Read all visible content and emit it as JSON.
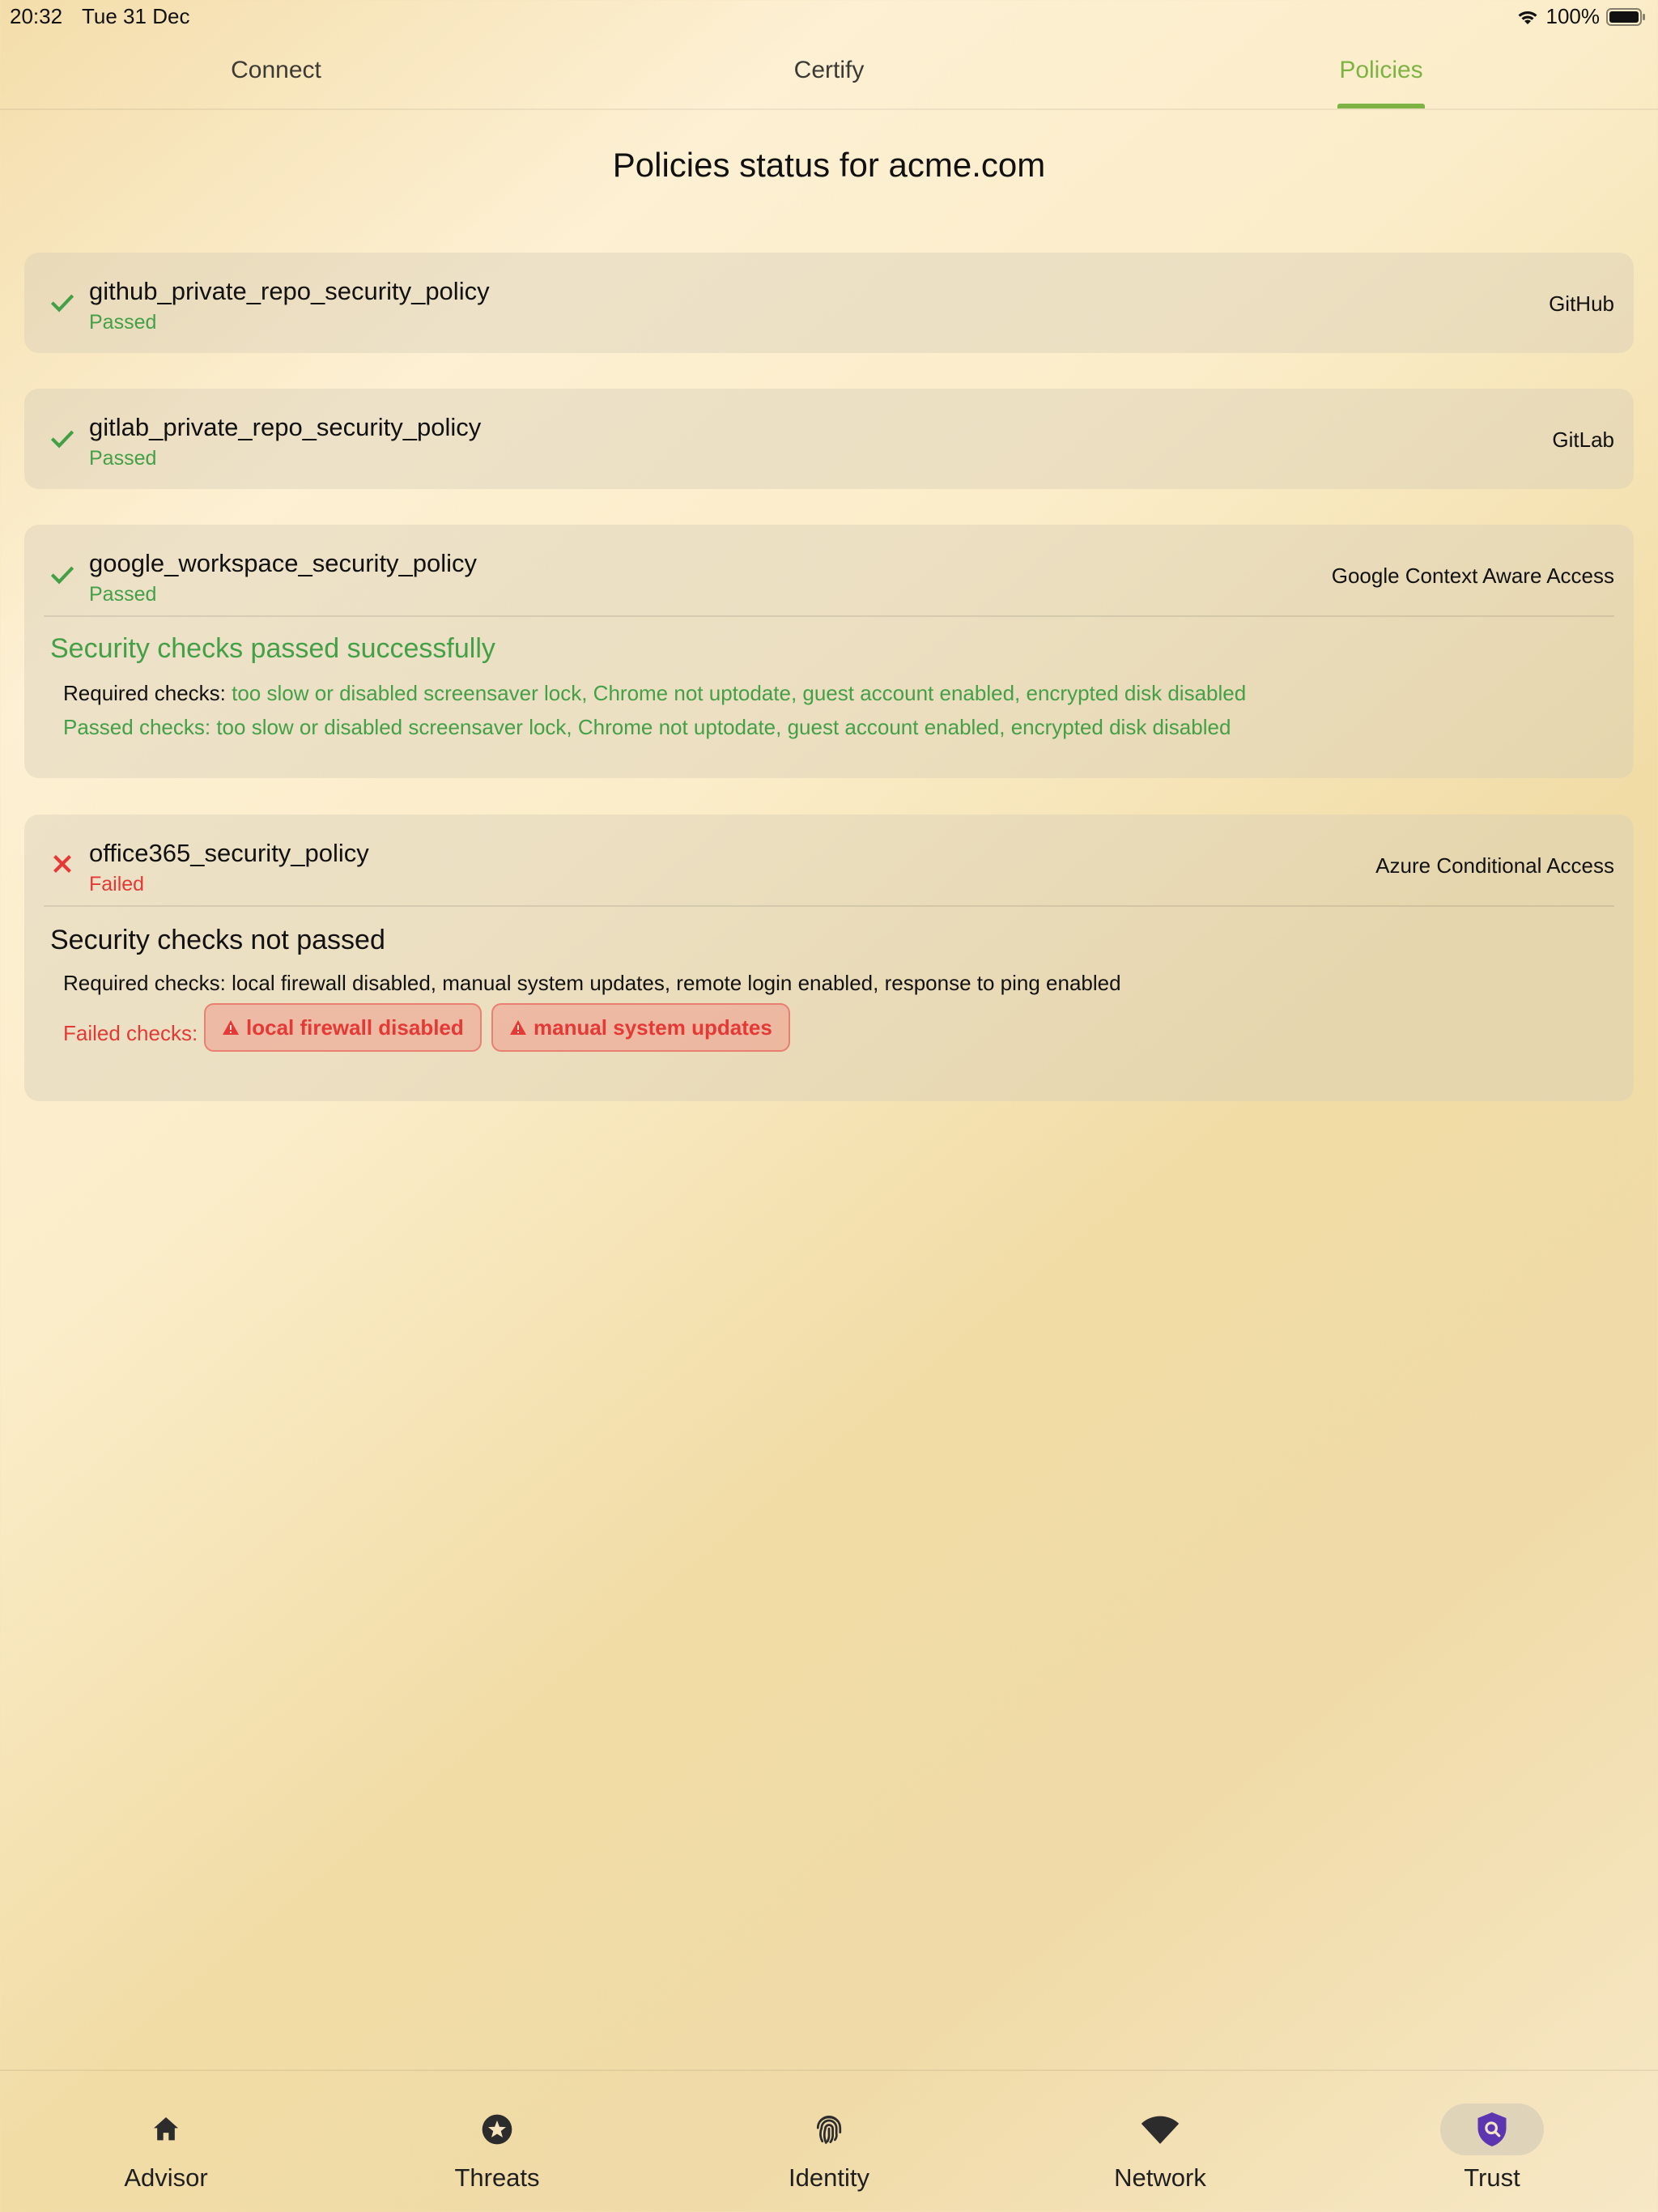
{
  "status_bar": {
    "time": "20:32",
    "date": "Tue 31 Dec",
    "battery": "100%"
  },
  "tabs": [
    {
      "label": "Connect",
      "active": false
    },
    {
      "label": "Certify",
      "active": false
    },
    {
      "label": "Policies",
      "active": true
    }
  ],
  "page_title": "Policies status for acme.com",
  "policies": [
    {
      "name": "github_private_repo_security_policy",
      "status": "Passed",
      "provider": "GitHub",
      "icon": "check-icon"
    },
    {
      "name": "gitlab_private_repo_security_policy",
      "status": "Passed",
      "provider": "GitLab",
      "icon": "check-icon"
    },
    {
      "name": "google_workspace_security_policy",
      "status": "Passed",
      "provider": "Google Context Aware Access",
      "icon": "check-icon",
      "details_title": "Security checks passed successfully",
      "required_label": "Required checks:",
      "required_value": "too slow or disabled screensaver lock, Chrome not uptodate, guest account enabled, encrypted disk disabled",
      "passed_label": "Passed checks:",
      "passed_value": "too slow or disabled screensaver lock, Chrome not uptodate, guest account enabled, encrypted disk disabled"
    },
    {
      "name": "office365_security_policy",
      "status": "Failed",
      "provider": "Azure Conditional Access",
      "icon": "close-icon",
      "details_title": "Security checks not passed",
      "required_label": "Required checks:",
      "required_value": "local firewall disabled, manual system updates, remote login enabled, response to ping enabled",
      "failed_label": "Failed checks:",
      "failed_chips": [
        "local firewall disabled",
        "manual system updates"
      ]
    }
  ],
  "bottom_nav": [
    {
      "label": "Advisor",
      "icon": "home-icon",
      "active": false
    },
    {
      "label": "Threats",
      "icon": "star-badge-icon",
      "active": false
    },
    {
      "label": "Identity",
      "icon": "fingerprint-icon",
      "active": false
    },
    {
      "label": "Network",
      "icon": "wifi-icon",
      "active": false
    },
    {
      "label": "Trust",
      "icon": "shield-search-icon",
      "active": true
    }
  ],
  "colors": {
    "accent": "#7cb342",
    "success": "#43a047",
    "error": "#e53935",
    "trust_icon": "#5e35b1"
  }
}
